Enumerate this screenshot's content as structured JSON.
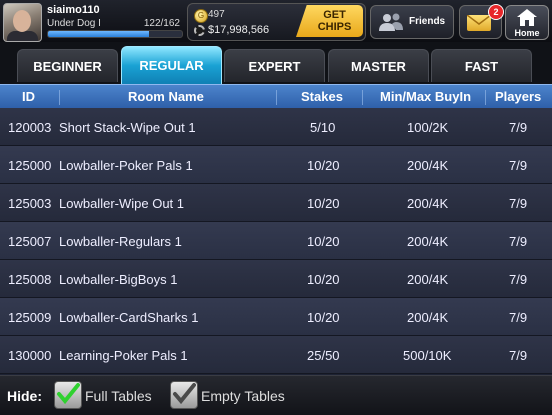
{
  "user": {
    "name": "siaimo110",
    "rank": "Under Dog I",
    "xp": "122/162",
    "xp_progress": 0.753
  },
  "wallet": {
    "coins": "497",
    "chips": "$17,998,566",
    "get_chips_line1": "GET",
    "get_chips_line2": "CHIPS"
  },
  "nav": {
    "friends_label": "Friends",
    "mail_badge": "2",
    "home_label": "Home"
  },
  "tabs": [
    {
      "label": "BEGINNER",
      "active": false
    },
    {
      "label": "REGULAR",
      "active": true
    },
    {
      "label": "EXPERT",
      "active": false
    },
    {
      "label": "MASTER",
      "active": false
    },
    {
      "label": "FAST",
      "active": false
    }
  ],
  "table": {
    "columns": [
      "ID",
      "Room Name",
      "Stakes",
      "Min/Max BuyIn",
      "Players"
    ],
    "rows": [
      {
        "id": "120003",
        "name": "Short Stack-Wipe Out 1",
        "stakes": "5/10",
        "buyin": "100/2K",
        "players": "7/9"
      },
      {
        "id": "125000",
        "name": "Lowballer-Poker Pals 1",
        "stakes": "10/20",
        "buyin": "200/4K",
        "players": "7/9"
      },
      {
        "id": "125003",
        "name": "Lowballer-Wipe Out 1",
        "stakes": "10/20",
        "buyin": "200/4K",
        "players": "7/9"
      },
      {
        "id": "125007",
        "name": "Lowballer-Regulars 1",
        "stakes": "10/20",
        "buyin": "200/4K",
        "players": "7/9"
      },
      {
        "id": "125008",
        "name": "Lowballer-BigBoys 1",
        "stakes": "10/20",
        "buyin": "200/4K",
        "players": "7/9"
      },
      {
        "id": "125009",
        "name": "Lowballer-CardSharks 1",
        "stakes": "10/20",
        "buyin": "200/4K",
        "players": "7/9"
      },
      {
        "id": "130000",
        "name": "Learning-Poker Pals 1",
        "stakes": "25/50",
        "buyin": "500/10K",
        "players": "7/9"
      }
    ]
  },
  "footer": {
    "hide_label": "Hide:",
    "full_tables": {
      "label": "Full Tables",
      "checked": true
    },
    "empty_tables": {
      "label": "Empty Tables",
      "checked": true
    }
  },
  "colors": {
    "active_tab": "#1aa2d4",
    "header": "#3d70ba",
    "check_full": "#2fd12f",
    "check_empty": "#4a4a4a",
    "gold": "#f0b830",
    "badge": "#e8262a"
  }
}
